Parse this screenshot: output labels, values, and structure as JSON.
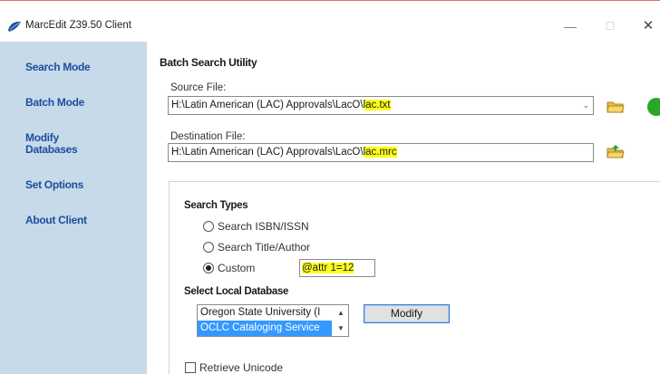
{
  "window": {
    "title": "MarcEdit Z39.50 Client",
    "minimize": "—",
    "maximize": "☐",
    "close": "✕"
  },
  "sidebar": {
    "items": [
      {
        "label": "Search Mode"
      },
      {
        "label": "Batch Mode"
      },
      {
        "label": "Modify\nDatabases"
      },
      {
        "label": "Set Options"
      },
      {
        "label": "About Client"
      }
    ]
  },
  "main": {
    "heading": "Batch Search Utility",
    "source": {
      "label": "Source File:",
      "value_prefix": "H:\\Latin American (LAC) Approvals\\LacO\\",
      "value_highlight": "lac.txt"
    },
    "destination": {
      "label": "Destination File:",
      "value_prefix": "H:\\Latin American (LAC) Approvals\\LacO\\",
      "value_highlight": "lac.mrc"
    },
    "search_types": {
      "title": "Search Types",
      "options": [
        {
          "label": "Search ISBN/ISSN",
          "selected": false
        },
        {
          "label": "Search Title/Author",
          "selected": false
        },
        {
          "label": "Custom",
          "selected": true
        }
      ],
      "custom_value": "@attr 1=12"
    },
    "local_db": {
      "title": "Select Local Database",
      "items": [
        {
          "label": "Oregon State University (I",
          "selected": false
        },
        {
          "label": "OCLC Cataloging Service",
          "selected": true
        }
      ],
      "modify_label": "Modify"
    },
    "retrieve_unicode": {
      "label": "Retrieve Unicode",
      "checked": false
    }
  },
  "colors": {
    "sidebar_bg": "#c6daea",
    "sidebar_text": "#1d4e9e",
    "highlight": "#ffff1a",
    "selection": "#3399ff"
  }
}
